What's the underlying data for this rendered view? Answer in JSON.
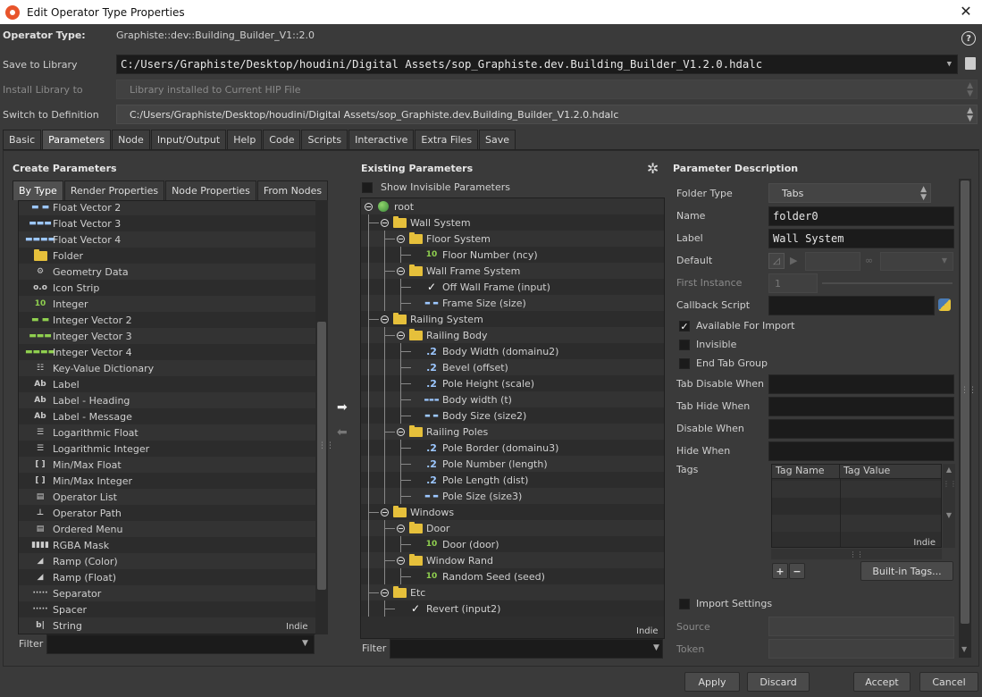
{
  "window": {
    "title": "Edit Operator Type Properties",
    "close_icon": "close-icon"
  },
  "header": {
    "operator_type_label": "Operator Type:",
    "operator_type_value": "Graphiste::dev::Building_Builder_V1::2.0",
    "save_to_library_label": "Save to Library",
    "save_to_library_value": "C:/Users/Graphiste/Desktop/houdini/Digital Assets/sop_Graphiste.dev.Building_Builder_V1.2.0.hdalc",
    "install_library_label": "Install Library to",
    "install_library_value": "Library installed to Current HIP File",
    "switch_definition_label": "Switch to Definition",
    "switch_definition_value": "C:/Users/Graphiste/Desktop/houdini/Digital Assets/sop_Graphiste.dev.Building_Builder_V1.2.0.hdalc"
  },
  "main_tabs": [
    "Basic",
    "Parameters",
    "Node",
    "Input/Output",
    "Help",
    "Code",
    "Scripts",
    "Interactive",
    "Extra Files",
    "Save"
  ],
  "create_parameters": {
    "title": "Create Parameters",
    "tabs": [
      "By Type",
      "Render Properties",
      "Node Properties",
      "From Nodes"
    ],
    "items": [
      {
        "icon": "float-vector-icon",
        "glyph": "▬ ▬",
        "label": "Float Vector 2"
      },
      {
        "icon": "float-vector-icon",
        "glyph": "▬▬▬",
        "label": "Float Vector 3"
      },
      {
        "icon": "float-vector-icon",
        "glyph": "▬▬▬▬",
        "label": "Float Vector 4"
      },
      {
        "icon": "folder-icon",
        "glyph": "F",
        "label": "Folder"
      },
      {
        "icon": "geometry-data-icon",
        "glyph": "⚙",
        "label": "Geometry Data"
      },
      {
        "icon": "icon-strip-icon",
        "glyph": "o.o",
        "label": "Icon Strip"
      },
      {
        "icon": "integer-icon",
        "glyph": "10",
        "label": "Integer"
      },
      {
        "icon": "integer-vector-icon",
        "glyph": "▬ ▬",
        "label": "Integer Vector 2"
      },
      {
        "icon": "integer-vector-icon",
        "glyph": "▬▬▬",
        "label": "Integer Vector 3"
      },
      {
        "icon": "integer-vector-icon",
        "glyph": "▬▬▬▬",
        "label": "Integer Vector 4"
      },
      {
        "icon": "key-value-icon",
        "glyph": "☷",
        "label": "Key-Value Dictionary"
      },
      {
        "icon": "label-icon",
        "glyph": "Ab",
        "label": "Label"
      },
      {
        "icon": "label-icon",
        "glyph": "Ab",
        "label": "Label - Heading"
      },
      {
        "icon": "label-icon",
        "glyph": "Ab",
        "label": "Label - Message"
      },
      {
        "icon": "log-float-icon",
        "glyph": "☰",
        "label": "Logarithmic Float"
      },
      {
        "icon": "log-integer-icon",
        "glyph": "☰",
        "label": "Logarithmic Integer"
      },
      {
        "icon": "minmax-icon",
        "glyph": "[ ]",
        "label": "Min/Max Float"
      },
      {
        "icon": "minmax-icon",
        "glyph": "[ ]",
        "label": "Min/Max Integer"
      },
      {
        "icon": "operator-list-icon",
        "glyph": "▤",
        "label": "Operator List"
      },
      {
        "icon": "operator-path-icon",
        "glyph": "⊥",
        "label": "Operator Path"
      },
      {
        "icon": "ordered-menu-icon",
        "glyph": "▤",
        "label": "Ordered Menu"
      },
      {
        "icon": "rgba-mask-icon",
        "glyph": "▮▮▮▮",
        "label": "RGBA Mask"
      },
      {
        "icon": "ramp-color-icon",
        "glyph": "◢",
        "label": "Ramp (Color)"
      },
      {
        "icon": "ramp-float-icon",
        "glyph": "◢",
        "label": "Ramp (Float)"
      },
      {
        "icon": "separator-icon",
        "glyph": "·····",
        "label": "Separator"
      },
      {
        "icon": "spacer-icon",
        "glyph": "·····",
        "label": "Spacer"
      },
      {
        "icon": "string-icon",
        "glyph": "b|",
        "label": "String"
      }
    ],
    "watermark": "Indie",
    "filter_label": "Filter"
  },
  "existing_parameters": {
    "title": "Existing Parameters",
    "show_invisible_label": "Show Invisible Parameters",
    "gear_icon": "gear-icon",
    "tree": [
      {
        "level": 0,
        "kind": "root",
        "label": "root"
      },
      {
        "level": 1,
        "kind": "folder",
        "label": "Wall System"
      },
      {
        "level": 2,
        "kind": "folder",
        "label": "Floor System"
      },
      {
        "level": 3,
        "kind": "int",
        "label": "Floor Number (ncy)"
      },
      {
        "level": 2,
        "kind": "folder",
        "label": "Wall Frame System"
      },
      {
        "level": 3,
        "kind": "toggle",
        "label": "Off Wall Frame (input)"
      },
      {
        "level": 3,
        "kind": "vec2",
        "label": "Frame Size (size)"
      },
      {
        "level": 1,
        "kind": "folder",
        "label": "Railing System"
      },
      {
        "level": 2,
        "kind": "folder",
        "label": "Railing Body"
      },
      {
        "level": 3,
        "kind": "float",
        "label": "Body Width (domainu2)"
      },
      {
        "level": 3,
        "kind": "float",
        "label": "Bevel (offset)"
      },
      {
        "level": 3,
        "kind": "float",
        "label": "Pole Height (scale)"
      },
      {
        "level": 3,
        "kind": "vec3",
        "label": "Body width (t)"
      },
      {
        "level": 3,
        "kind": "vec2",
        "label": "Body Size (size2)"
      },
      {
        "level": 2,
        "kind": "folder",
        "label": "Railing Poles"
      },
      {
        "level": 3,
        "kind": "float",
        "label": "Pole Border (domainu3)"
      },
      {
        "level": 3,
        "kind": "float",
        "label": "Pole Number (length)"
      },
      {
        "level": 3,
        "kind": "float",
        "label": "Pole Length (dist)"
      },
      {
        "level": 3,
        "kind": "vec2",
        "label": "Pole Size (size3)"
      },
      {
        "level": 1,
        "kind": "folder",
        "label": "Windows"
      },
      {
        "level": 2,
        "kind": "folder",
        "label": "Door"
      },
      {
        "level": 3,
        "kind": "int",
        "label": "Door (door)"
      },
      {
        "level": 2,
        "kind": "folder",
        "label": "Window Rand"
      },
      {
        "level": 3,
        "kind": "int",
        "label": "Random Seed (seed)"
      },
      {
        "level": 1,
        "kind": "folder",
        "label": "Etc"
      },
      {
        "level": 2,
        "kind": "toggle",
        "label": "Revert (input2)"
      }
    ],
    "watermark": "Indie",
    "filter_label": "Filter"
  },
  "parameter_description": {
    "title": "Parameter Description",
    "folder_type_label": "Folder Type",
    "folder_type_value": "Tabs",
    "name_label": "Name",
    "name_value": "folder0",
    "label_label": "Label",
    "label_value": "Wall System",
    "default_label": "Default",
    "first_instance_label": "First Instance",
    "first_instance_value": "1",
    "callback_script_label": "Callback Script",
    "available_for_import_label": "Available For Import",
    "available_for_import_checked": true,
    "invisible_label": "Invisible",
    "end_tab_group_label": "End Tab Group",
    "tab_disable_when_label": "Tab Disable When",
    "tab_hide_when_label": "Tab Hide When",
    "disable_when_label": "Disable When",
    "hide_when_label": "Hide When",
    "tags_label": "Tags",
    "tags_columns": [
      "Tag Name",
      "Tag Value"
    ],
    "tags_watermark": "Indie",
    "add_label": "+",
    "remove_label": "−",
    "builtin_tags_label": "Built-in Tags...",
    "import_settings_label": "Import Settings",
    "source_label": "Source",
    "token_label": "Token"
  },
  "footer": {
    "apply": "Apply",
    "discard": "Discard",
    "accept": "Accept",
    "cancel": "Cancel"
  },
  "colors": {
    "background": "#3a3a3a",
    "field": "#1b1b1b",
    "folder": "#e6c03b",
    "integer_icon": "#8fcf4f",
    "float_icon": "#9cc7ff"
  }
}
